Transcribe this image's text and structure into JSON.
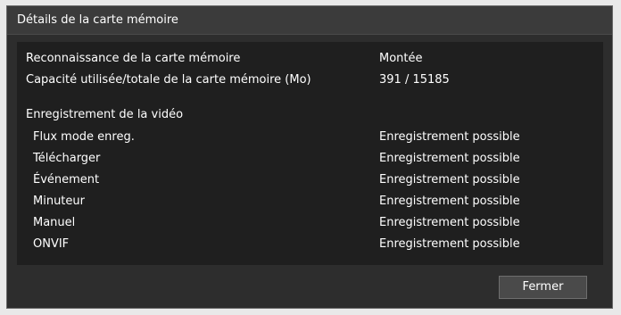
{
  "dialog": {
    "title": "Détails de la carte mémoire",
    "card_info": [
      {
        "label": "Reconnaissance de la carte mémoire",
        "value": "Montée"
      },
      {
        "label": "Capacité utilisée/totale de la carte mémoire (Mo)",
        "value": "391 / 15185"
      }
    ],
    "recording_section_title": "Enregistrement de la vidéo",
    "recording_items": [
      {
        "label": "Flux mode enreg.",
        "value": "Enregistrement possible"
      },
      {
        "label": "Télécharger",
        "value": "Enregistrement possible"
      },
      {
        "label": "Événement",
        "value": "Enregistrement possible"
      },
      {
        "label": "Minuteur",
        "value": "Enregistrement possible"
      },
      {
        "label": "Manuel",
        "value": "Enregistrement possible"
      },
      {
        "label": "ONVIF",
        "value": "Enregistrement possible"
      }
    ],
    "close_button_label": "Fermer"
  }
}
